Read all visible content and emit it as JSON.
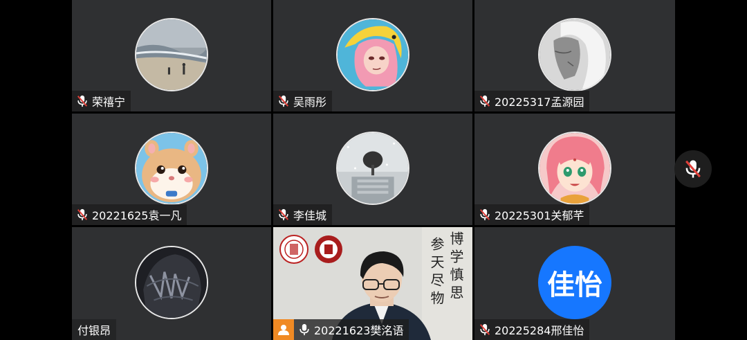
{
  "participants": [
    {
      "name": "荣禧宁",
      "mic": "muted",
      "avatar": "beach-photo"
    },
    {
      "name": "吴雨彤",
      "mic": "muted",
      "avatar": "anime-girl-pink-hair"
    },
    {
      "name": "20225317孟源园",
      "mic": "muted",
      "avatar": "white-hair-character"
    },
    {
      "name": "20221625袁一凡",
      "mic": "muted",
      "avatar": "hamster"
    },
    {
      "name": "李佳城",
      "mic": "muted",
      "avatar": "snowy-tree-photo"
    },
    {
      "name": "20225301关郁芊",
      "mic": "muted",
      "avatar": "anime-girl-red-hair"
    },
    {
      "name": "付银昂",
      "mic": "none",
      "avatar": "dark-hooded-character"
    },
    {
      "name": "20221623樊洺语",
      "mic": "on",
      "role": "host",
      "video": true
    },
    {
      "name": "20225284邢佳怡",
      "mic": "muted",
      "avatar_text": "佳怡"
    }
  ],
  "active_scene": {
    "calligraphy_left": "参天尽物",
    "calligraphy_right": "博学慎思"
  },
  "colors": {
    "tile_bg": "#2f3032",
    "muted_red": "#e0403a",
    "host_badge": "#f08a24",
    "text_avatar": "#1677ff"
  },
  "side_controls": {
    "mic_state": "muted",
    "icon": "mic-muted-icon"
  }
}
